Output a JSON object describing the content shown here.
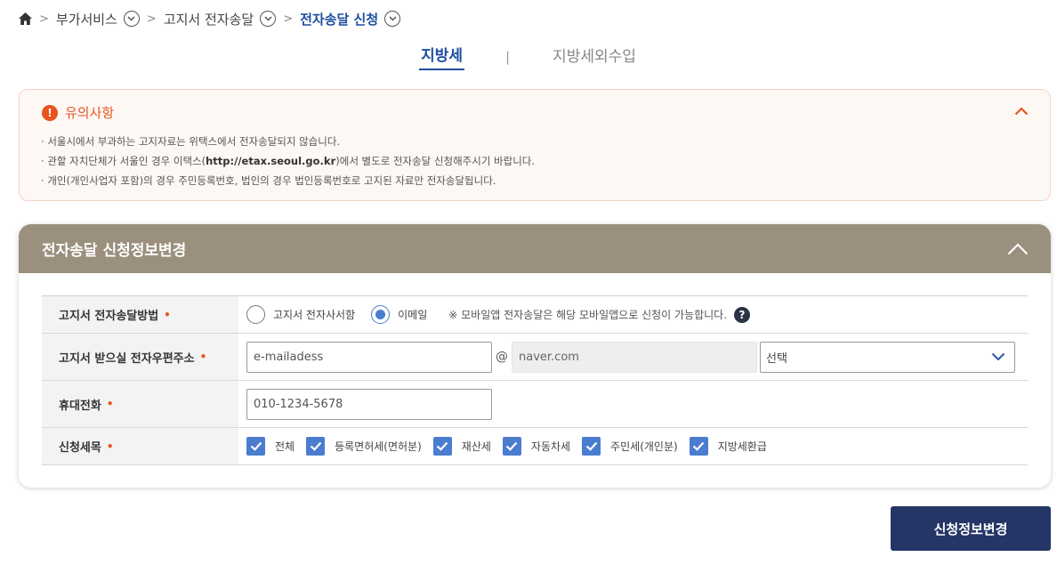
{
  "breadcrumb": {
    "items": [
      {
        "label": "부가서비스"
      },
      {
        "label": "고지서 전자송달"
      },
      {
        "label": "전자송달 신청"
      }
    ]
  },
  "tabs": [
    {
      "label": "지방세",
      "active": true
    },
    {
      "label": "지방세외수입",
      "active": false
    }
  ],
  "notice": {
    "title": "유의사항",
    "items": [
      {
        "text": "서울시에서 부과하는 고지자료는 위택스에서 전자송달되지 않습니다."
      },
      {
        "prefix": "관할 자치단체가 서울인 경우 이택스(",
        "link": "http://etax.seoul.go.kr",
        "suffix": ")에서 별도로 전자송달 신청해주시기 바랍니다."
      },
      {
        "text": "개인(개인사업자 포함)의 경우 주민등록번호, 법인의 경우 법인등록번호로 고지된 자료만 전자송달됩니다."
      }
    ]
  },
  "panel": {
    "title": "전자송달 신청정보변경"
  },
  "form": {
    "method": {
      "label": "고지서 전자송달방법",
      "required_mark": "•",
      "options": [
        {
          "label": "고지서 전자사서함",
          "selected": false
        },
        {
          "label": "이메일",
          "selected": true
        }
      ],
      "hint": "※ 모바일앱 전자송달은 해당 모바일앱으로 신청이 가능합니다."
    },
    "email": {
      "label": "고지서 받으실 전자우편주소",
      "required_mark": "•",
      "id_value": "e-mailadess",
      "at": "@",
      "domain_value": "naver.com",
      "select_value": "선택"
    },
    "phone": {
      "label": "휴대전화",
      "required_mark": "•",
      "value": "010-1234-5678"
    },
    "items": {
      "label": "신청세목",
      "required_mark": "•",
      "options": [
        {
          "label": "전체",
          "checked": true
        },
        {
          "label": "등록면허세(면허분)",
          "checked": true
        },
        {
          "label": "재산세",
          "checked": true
        },
        {
          "label": "자동차세",
          "checked": true
        },
        {
          "label": "주민세(개인분)",
          "checked": true
        },
        {
          "label": "지방세환급",
          "checked": true
        }
      ]
    }
  },
  "submit_label": "신청정보변경",
  "colors": {
    "accent": "#1e4fa0",
    "warning": "#e8541e",
    "panel_header": "#9b8f7e",
    "checkbox": "#4a7dcf",
    "submit": "#243566"
  }
}
